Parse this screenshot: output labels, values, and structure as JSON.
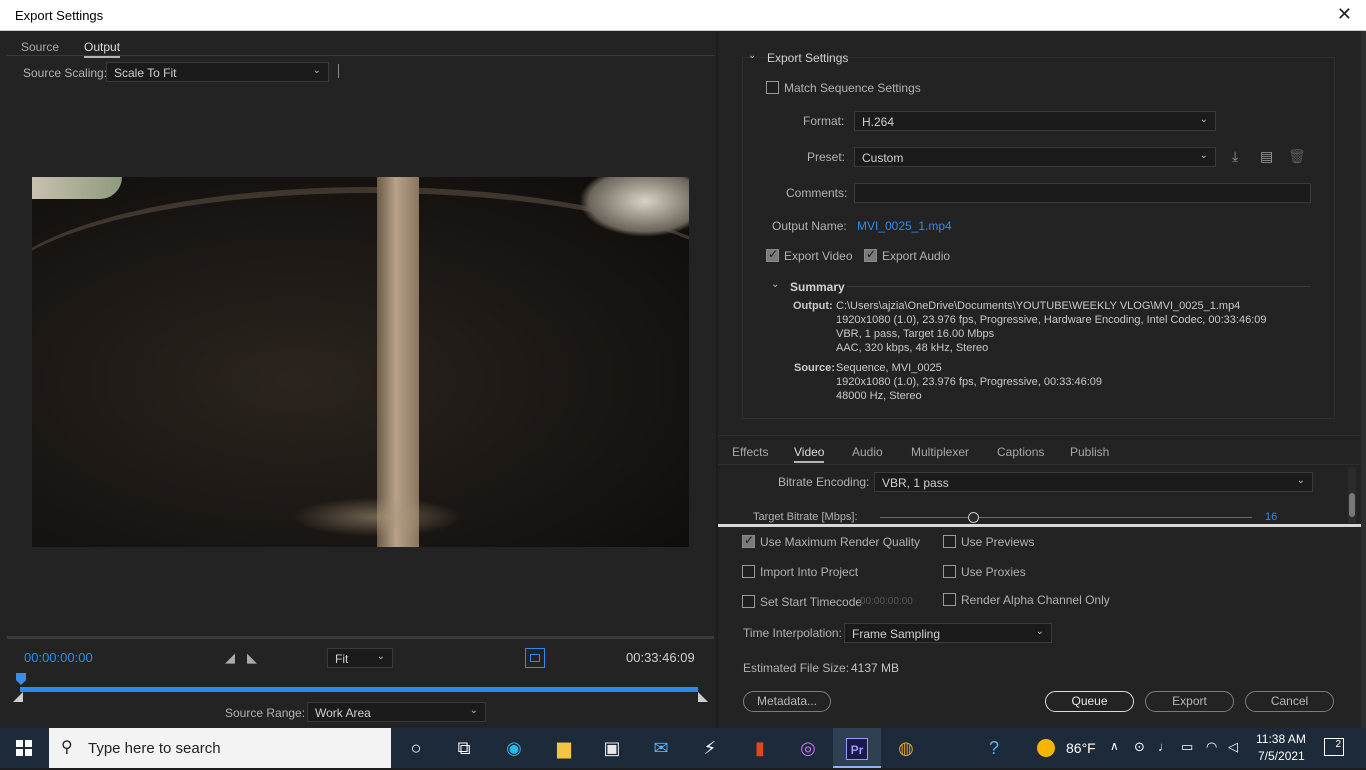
{
  "window": {
    "title": "Export Settings",
    "close": "✕"
  },
  "left": {
    "tabs": [
      "Source",
      "Output"
    ],
    "source_scaling_label": "Source Scaling:",
    "source_scaling_value": "Scale To Fit",
    "timecode_start": "00:00:00:00",
    "timecode_end": "00:33:46:09",
    "fit_value": "Fit",
    "source_range_label": "Source Range:",
    "source_range_value": "Work Area"
  },
  "export": {
    "section_title": "Export Settings",
    "match_sequence": "Match Sequence Settings",
    "format_label": "Format:",
    "format_value": "H.264",
    "preset_label": "Preset:",
    "preset_value": "Custom",
    "comments_label": "Comments:",
    "output_name_label": "Output Name:",
    "output_name_value": "MVI_0025_1.mp4",
    "export_video": "Export Video",
    "export_audio": "Export Audio"
  },
  "summary": {
    "title": "Summary",
    "output_label": "Output:",
    "output_lines": [
      "C:\\Users\\ajzia\\OneDrive\\Documents\\YOUTUBE\\WEEKLY VLOG\\MVI_0025_1.mp4",
      "1920x1080 (1.0), 23.976 fps, Progressive, Hardware Encoding, Intel Codec, 00:33:46:09",
      "VBR, 1 pass, Target 16.00 Mbps",
      "AAC, 320 kbps, 48 kHz, Stereo"
    ],
    "source_label": "Source:",
    "source_lines": [
      "Sequence, MVI_0025",
      "1920x1080 (1.0), 23.976 fps, Progressive, 00:33:46:09",
      "48000 Hz, Stereo"
    ]
  },
  "tabs2": [
    "Effects",
    "Video",
    "Audio",
    "Multiplexer",
    "Captions",
    "Publish"
  ],
  "video": {
    "bitrate_encoding_label": "Bitrate Encoding:",
    "bitrate_encoding_value": "VBR, 1 pass",
    "target_bitrate_label": "Target Bitrate [Mbps]:",
    "target_bitrate_value": "16",
    "target_bitrate_fraction": 0.25
  },
  "options": {
    "max_render": "Use Maximum Render Quality",
    "use_previews": "Use Previews",
    "import_project": "Import Into Project",
    "use_proxies": "Use Proxies",
    "set_start_tc": "Set Start Timecode",
    "start_tc_value": "00:00:00:00",
    "render_alpha": "Render Alpha Channel Only",
    "time_interp_label": "Time Interpolation:",
    "time_interp_value": "Frame Sampling",
    "est_size_label": "Estimated File Size:",
    "est_size_value": "4137 MB"
  },
  "buttons": {
    "metadata": "Metadata...",
    "queue": "Queue",
    "export": "Export",
    "cancel": "Cancel"
  },
  "taskbar": {
    "search_placeholder": "Type here to search",
    "weather": "86°F",
    "time": "11:38 AM",
    "date": "7/5/2021",
    "notifications": "2"
  },
  "colors": {
    "accent": "#2d8ceb",
    "bg": "#232323",
    "taskbar": "#1c2a3a"
  }
}
